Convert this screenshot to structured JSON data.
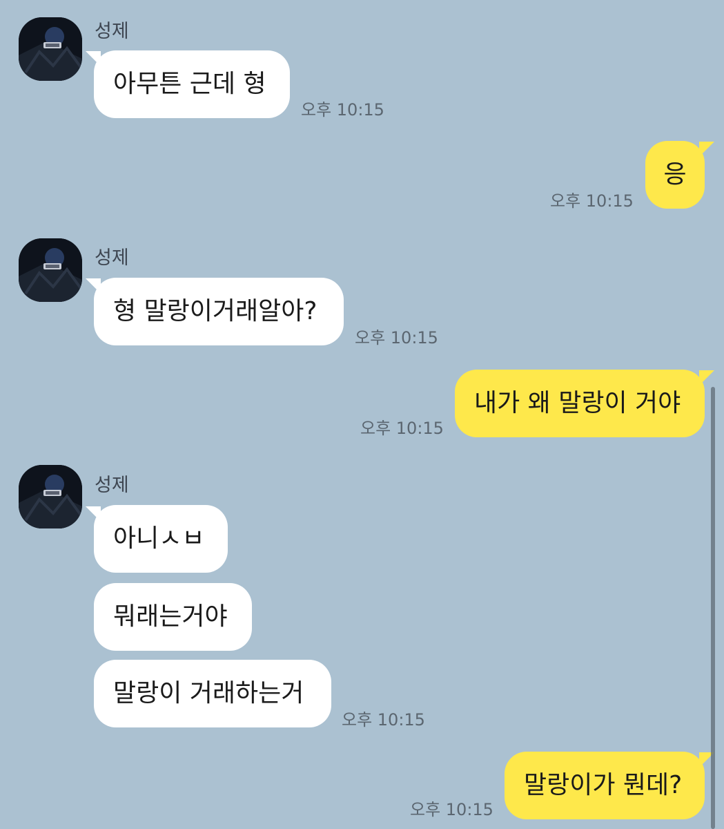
{
  "chat": {
    "messages": [
      {
        "side": "in",
        "sender": "성제",
        "text": "아무튼 근데 형",
        "time": "오후 10:15"
      },
      {
        "side": "out",
        "text": "응",
        "time": "오후 10:15"
      },
      {
        "side": "in",
        "sender": "성제",
        "text": "형 말랑이거래알아?",
        "time": "오후 10:15"
      },
      {
        "side": "out",
        "text": "내가 왜 말랑이 거야",
        "time": "오후 10:15"
      },
      {
        "side": "in",
        "sender": "성제",
        "text": "아니ㅅㅂ"
      },
      {
        "side": "in",
        "text": "뭐래는거야"
      },
      {
        "side": "in",
        "text": "말랑이 거래하는거",
        "time": "오후 10:15"
      },
      {
        "side": "out",
        "text": "말랑이가 뭔데?",
        "time": "오후 10:15"
      }
    ]
  },
  "colors": {
    "background": "#abc1d1",
    "incoming_bubble": "#ffffff",
    "outgoing_bubble": "#fee84b"
  },
  "icons": {
    "avatar": "profile-photo",
    "scrollbar": "vertical-scrollbar"
  }
}
